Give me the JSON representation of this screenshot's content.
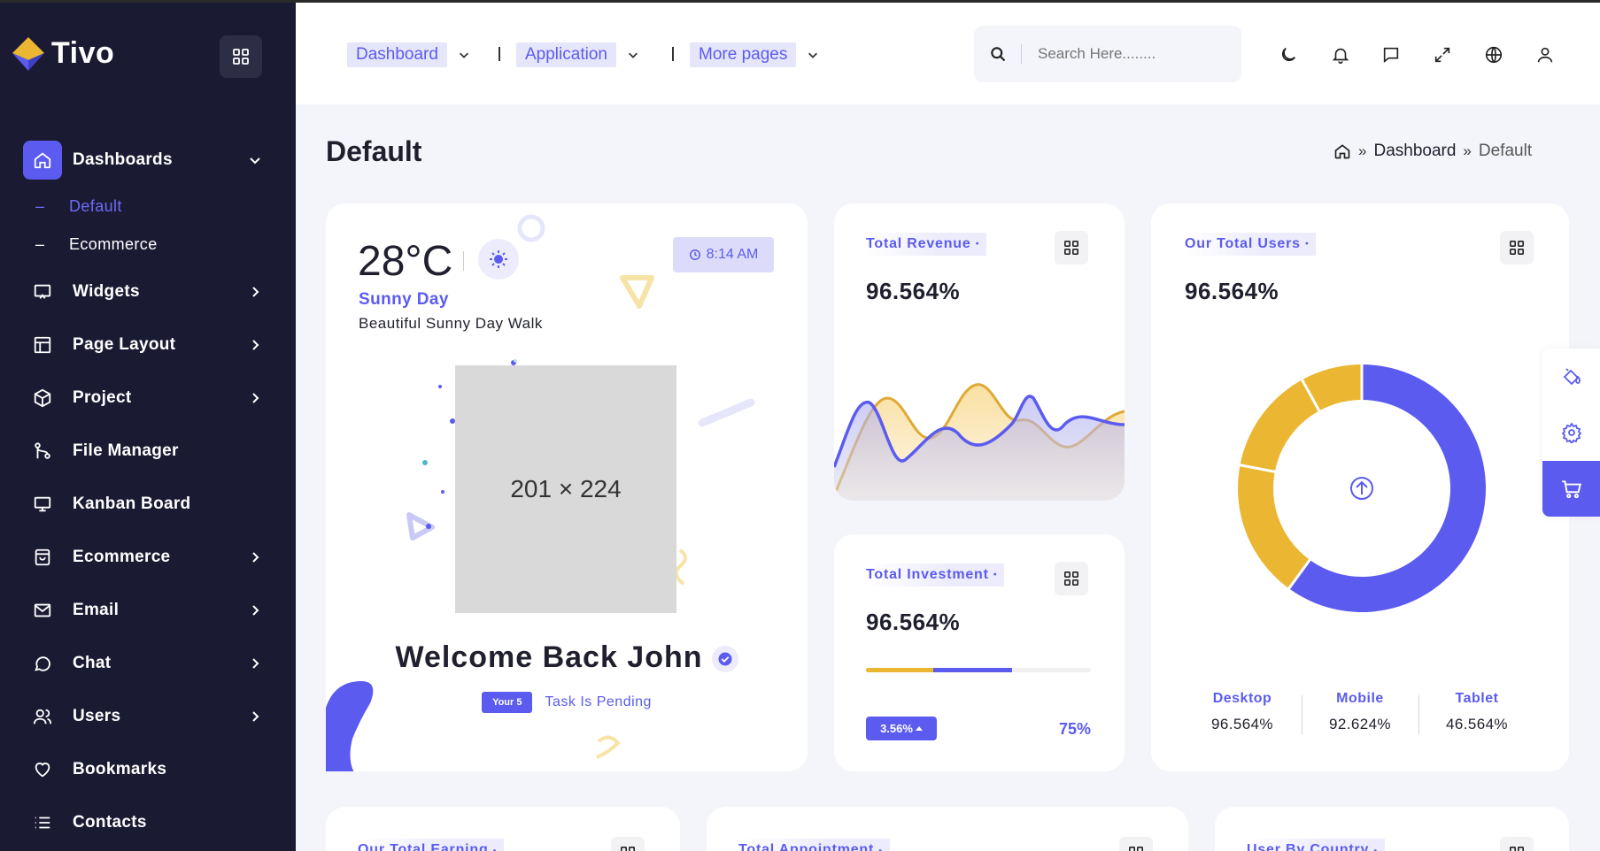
{
  "brand": {
    "name": "Tivo"
  },
  "sidebar": {
    "items": [
      {
        "label": "Dashboards",
        "icon": "home-icon"
      },
      {
        "label": "Widgets",
        "icon": "widget-icon"
      },
      {
        "label": "Page Layout",
        "icon": "layout-icon"
      },
      {
        "label": "Project",
        "icon": "box-icon"
      },
      {
        "label": "File Manager",
        "icon": "git-icon"
      },
      {
        "label": "Kanban Board",
        "icon": "monitor-icon"
      },
      {
        "label": "Ecommerce",
        "icon": "bag-icon"
      },
      {
        "label": "Email",
        "icon": "mail-icon"
      },
      {
        "label": "Chat",
        "icon": "chat-icon"
      },
      {
        "label": "Users",
        "icon": "users-icon"
      },
      {
        "label": "Bookmarks",
        "icon": "heart-icon"
      },
      {
        "label": "Contacts",
        "icon": "list-icon"
      }
    ],
    "subitems": [
      {
        "label": "Default"
      },
      {
        "label": "Ecommerce"
      }
    ]
  },
  "header": {
    "nav": [
      {
        "label": "Dashboard"
      },
      {
        "label": "Application"
      },
      {
        "label": "More pages"
      }
    ],
    "search_placeholder": "Search Here........"
  },
  "page": {
    "title": "Default",
    "breadcrumb": [
      "Dashboard",
      "Default"
    ]
  },
  "welcome": {
    "temperature": "28°C",
    "time": "8:14 AM",
    "weather": "Sunny Day",
    "weather_desc": "Beautiful Sunny Day Walk",
    "placeholder": "201 × 224",
    "greeting": "Welcome Back John",
    "tag": "Your 5",
    "pending": "Task Is Pending"
  },
  "revenue": {
    "title": "Total Revenue",
    "value": "96.564%"
  },
  "investment": {
    "title": "Total Investment",
    "value": "96.564%",
    "change": "3.56%",
    "percent": "75%",
    "progress_segment_1": 0.3,
    "progress_segment_2": 0.35
  },
  "users": {
    "title": "Our Total Users",
    "value": "96.564%",
    "legend": [
      {
        "label": "Desktop",
        "value": "96.564%"
      },
      {
        "label": "Mobile",
        "value": "92.624%"
      },
      {
        "label": "Tablet",
        "value": "46.564%"
      }
    ],
    "donut_shares": [
      0.6,
      0.4
    ],
    "colors": {
      "primary": "#5b5bf0",
      "secondary": "#ebb732"
    }
  },
  "bottom_cards": [
    {
      "title": "Our Total Earning"
    },
    {
      "title": "Total Appointment"
    },
    {
      "title": "User By Country"
    }
  ]
}
